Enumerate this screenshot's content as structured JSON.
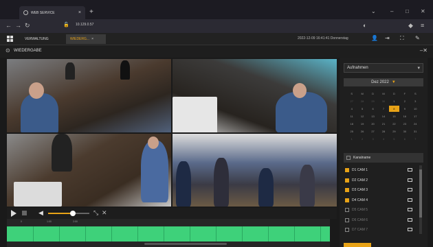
{
  "browser": {
    "tab_title": "WEB SERVICE",
    "url": "10.129.0.57",
    "new_tab": "+",
    "tab_close": "×"
  },
  "app_header": {
    "tabs": [
      "VERWALTUNG",
      "WIEDERG..."
    ],
    "datetime": "2022-12-09 16:41:41 Donnerstag"
  },
  "section": {
    "title": "WIEDERGABE"
  },
  "playback": {
    "volume": 0.6
  },
  "timeline": {
    "ticks": [
      "0",
      "1:00",
      "2:00",
      "",
      "",
      "",
      "",
      "",
      "",
      "",
      "",
      ""
    ]
  },
  "right_panel": {
    "dropdown_value": "Aufnahmen",
    "calendar": {
      "month": "Dez 2022",
      "weekdays": [
        "S",
        "M",
        "D",
        "M",
        "D",
        "F",
        "S"
      ],
      "days": [
        [
          "27",
          "28",
          "29",
          "30",
          "1",
          "2",
          "3"
        ],
        [
          "4",
          "5",
          "6",
          "7",
          "8",
          "9",
          "10"
        ],
        [
          "11",
          "12",
          "13",
          "14",
          "15",
          "16",
          "17"
        ],
        [
          "18",
          "19",
          "20",
          "21",
          "22",
          "23",
          "24"
        ],
        [
          "25",
          "26",
          "27",
          "28",
          "29",
          "30",
          "31"
        ],
        [
          "1",
          "2",
          "3",
          "4",
          "5",
          "6",
          "7"
        ]
      ],
      "selected_day": "8"
    },
    "channel_header": "Kanalname",
    "channels": [
      {
        "label": "D1 CAM 1",
        "checked": true
      },
      {
        "label": "D2 CAM 2",
        "checked": true
      },
      {
        "label": "D3 CAM 3",
        "checked": true
      },
      {
        "label": "D4 CAM 4",
        "checked": true
      },
      {
        "label": "D5 CAM 5",
        "checked": false
      },
      {
        "label": "D6 CAM 6",
        "checked": false
      },
      {
        "label": "D7 CAM 7",
        "checked": false
      }
    ]
  }
}
